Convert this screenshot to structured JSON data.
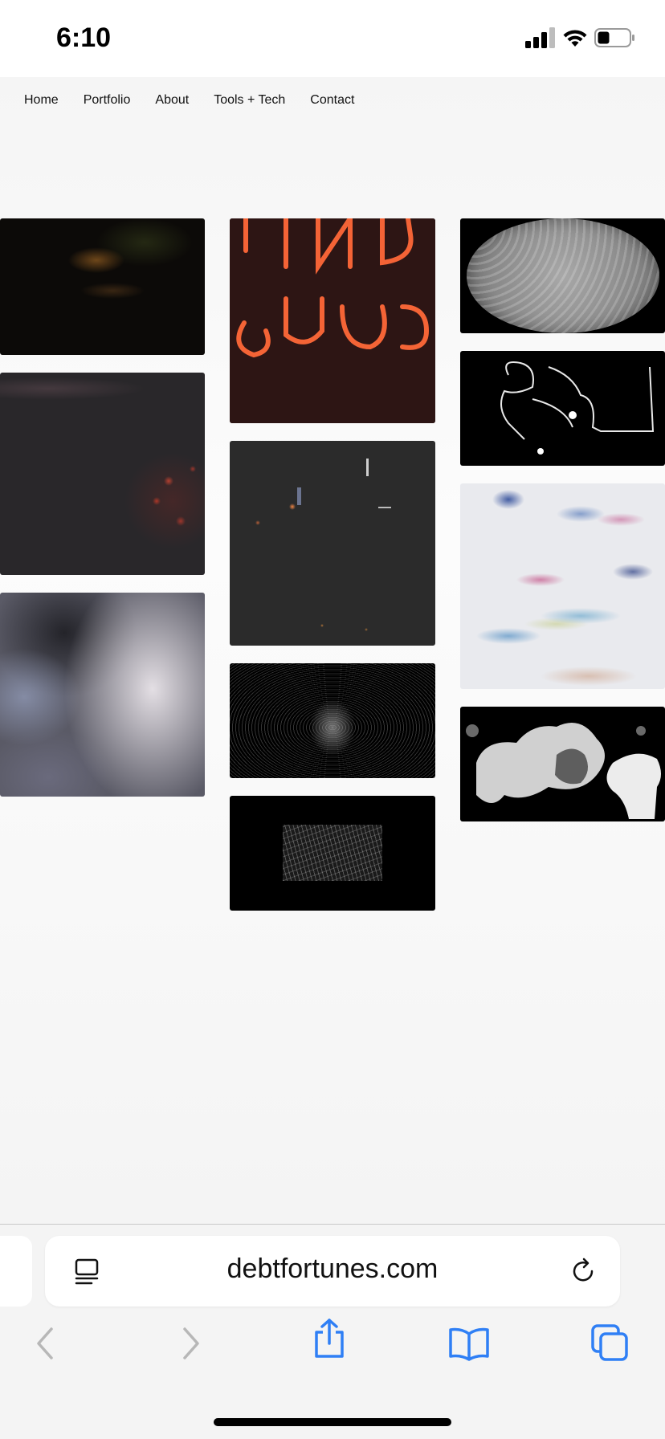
{
  "status": {
    "time": "6:10"
  },
  "nav": {
    "items": [
      {
        "label": "Home"
      },
      {
        "label": "Portfolio"
      },
      {
        "label": "About"
      },
      {
        "label": "Tools + Tech"
      },
      {
        "label": "Contact"
      }
    ]
  },
  "gallery": {
    "tiles": [
      {
        "name": "night-street-photo",
        "column": 1
      },
      {
        "name": "dark-red-bokeh-photo",
        "column": 1
      },
      {
        "name": "blurred-white-fabric-photo",
        "column": 1
      },
      {
        "name": "neon-sign-photo",
        "column": 2
      },
      {
        "name": "dark-lights-photo",
        "column": 2
      },
      {
        "name": "fingerprint-particles-image",
        "column": 2
      },
      {
        "name": "edge-detect-street-image",
        "column": 2
      },
      {
        "name": "gray-circles-texture-image",
        "column": 3
      },
      {
        "name": "white-outline-sketch-image",
        "column": 3
      },
      {
        "name": "pastel-paint-texture-image",
        "column": 3
      },
      {
        "name": "gray-blob-shapes-image",
        "column": 3
      }
    ]
  },
  "browser": {
    "url": "debtfortunes.com",
    "accent_color": "#2f7ff5"
  }
}
